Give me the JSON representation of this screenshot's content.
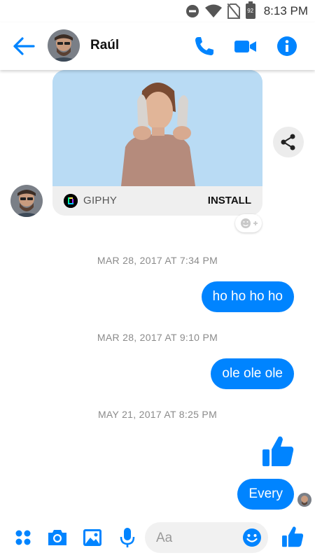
{
  "status_bar": {
    "time": "8:13 PM",
    "battery_level": "92",
    "icons": [
      "do-not-disturb-icon",
      "wifi-icon",
      "no-sim-icon",
      "battery-icon"
    ]
  },
  "header": {
    "contact_name": "Raúl",
    "icons": [
      "back-arrow-icon",
      "phone-icon",
      "video-camera-icon",
      "info-icon"
    ]
  },
  "gif_message": {
    "source_label": "GIPHY",
    "action_label": "INSTALL"
  },
  "timestamps": [
    "MAR 28, 2017 AT 7:34 PM",
    "MAR 28, 2017 AT 9:10 PM",
    "MAY 21, 2017 AT 8:25 PM"
  ],
  "messages": [
    {
      "text": "ho ho ho ho"
    },
    {
      "text": "ole ole ole"
    },
    {
      "text": "Every"
    }
  ],
  "composer": {
    "placeholder": "Aa",
    "icons": [
      "apps-icon",
      "camera-icon",
      "gallery-icon",
      "microphone-icon",
      "emoji-icon",
      "like-thumb-icon"
    ]
  },
  "colors": {
    "accent": "#0084ff",
    "gif_background": "#b9dbf4",
    "timestamp": "#8b8b8b"
  }
}
